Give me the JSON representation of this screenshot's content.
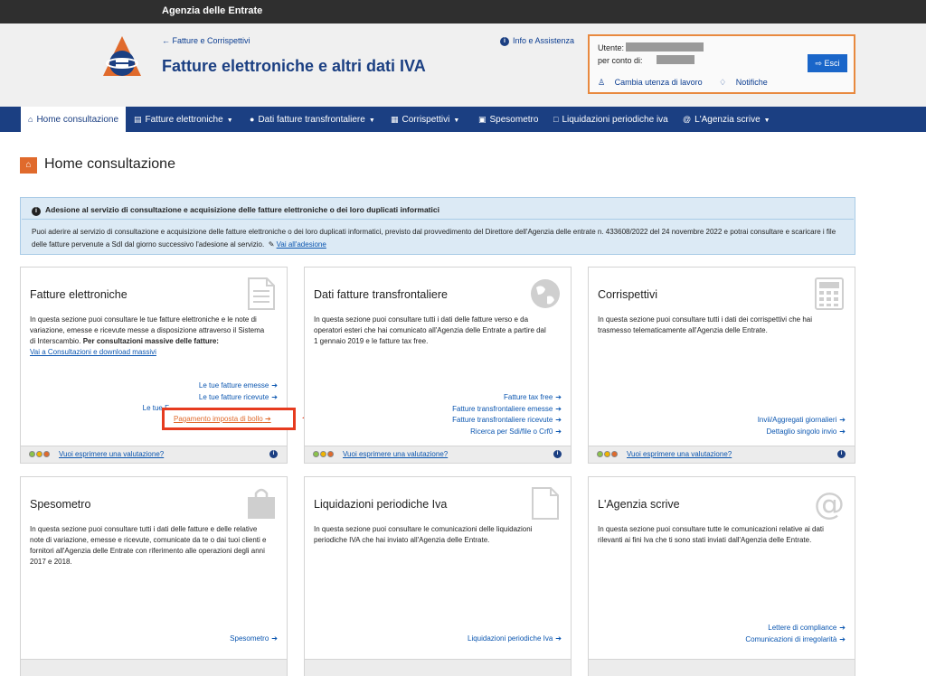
{
  "topbar": {
    "agency": "Agenzia delle Entrate"
  },
  "header": {
    "back_link": "Fatture e Corrispettivi",
    "title": "Fatture elettroniche e altri dati IVA",
    "info_link": "Info e Assistenza"
  },
  "user": {
    "user_label": "Utente:",
    "on_behalf_label": "per conto di:",
    "logout": "Esci",
    "change_workspace": "Cambia utenza di lavoro",
    "notifications": "Notifiche"
  },
  "nav": {
    "items": [
      {
        "label": "Home consultazione",
        "icon": "home-icon"
      },
      {
        "label": "Fatture elettroniche",
        "icon": "document-icon"
      },
      {
        "label": "Dati fatture transfrontaliere",
        "icon": "globe-icon"
      },
      {
        "label": "Corrispettivi",
        "icon": "calculator-icon"
      },
      {
        "label": "Spesometro",
        "icon": "bag-icon"
      },
      {
        "label": "Liquidazioni periodiche iva",
        "icon": "file-icon"
      },
      {
        "label": "L'Agenzia scrive",
        "icon": "at-icon"
      }
    ]
  },
  "page": {
    "title": "Home consultazione"
  },
  "alert": {
    "title": "Adesione al servizio di consultazione e acquisizione delle fatture elettroniche o dei loro duplicati informatici",
    "body": "Puoi aderire al servizio di consultazione e acquisizione delle fatture elettroniche o dei loro duplicati informatici, previsto dal provvedimento del Direttore dell'Agenzia delle entrate n. 433608/2022 del 24 novembre 2022 e potrai consultare e scaricare i file delle fatture pervenute a SdI dal giorno successivo l'adesione al servizio.",
    "link": "Vai all'adesione"
  },
  "cards": [
    {
      "title": "Fatture elettroniche",
      "desc_1": "In questa sezione puoi consultare le tue fatture elettroniche e le note di variazione, emesse e ricevute messe a disposizione attraverso il Sistema di Interscambio.",
      "desc_bold": "Per consultazioni massive delle fatture:",
      "desc_link": "Vai a Consultazioni e download massivi",
      "links": [
        "Le tue fatture emesse",
        "Le tue fatture ricevute",
        "Le tue F"
      ],
      "highlight_link": "Pagamento imposta di bollo",
      "rate": "Vuoi esprimere una valutazione?"
    },
    {
      "title": "Dati fatture transfrontaliere",
      "desc_1": "In questa sezione puoi consultare tutti i dati delle fatture verso e da operatori esteri che hai comunicato all'Agenzia delle Entrate a partire dal 1 gennaio 2019 e le fatture tax free.",
      "links": [
        "Fatture tax free",
        "Fatture transfrontaliere emesse",
        "Fatture transfrontaliere ricevute",
        "Ricerca per Sdi/file o Crf0"
      ],
      "rate": "Vuoi esprimere una valutazione?"
    },
    {
      "title": "Corrispettivi",
      "desc_1": "In questa sezione puoi consultare tutti i dati dei corrispettivi che hai trasmesso telematicamente all'Agenzia delle Entrate.",
      "links": [
        "Invii/Aggregati giornalieri",
        "Dettaglio singolo invio"
      ],
      "rate": "Vuoi esprimere una valutazione?"
    },
    {
      "title": "Spesometro",
      "desc_1": "In questa sezione puoi consultare tutti i dati delle fatture e delle relative note di variazione, emesse e ricevute, comunicate da te o dai tuoi clienti e fornitori all'Agenzia delle Entrate con riferimento alle operazioni degli anni 2017 e 2018.",
      "links": [
        "Spesometro"
      ]
    },
    {
      "title": "Liquidazioni periodiche Iva",
      "desc_1": "In questa sezione puoi consultare le comunicazioni delle liquidazioni periodiche IVA che hai inviato all'Agenzia delle Entrate.",
      "links": [
        "Liquidazioni periodiche Iva"
      ]
    },
    {
      "title": "L'Agenzia scrive",
      "desc_1": "In questa sezione puoi consultare tutte le comunicazioni relative ai dati rilevanti ai fini Iva che ti sono stati inviati dall'Agenzia delle Entrate.",
      "links": [
        "Lettere di compliance",
        "Comunicazioni di irregolarità"
      ]
    }
  ],
  "colors": {
    "nav_bg": "#1b3f82",
    "accent": "#e06a2c",
    "highlight": "#e63b1f",
    "link": "#0b56b0"
  }
}
